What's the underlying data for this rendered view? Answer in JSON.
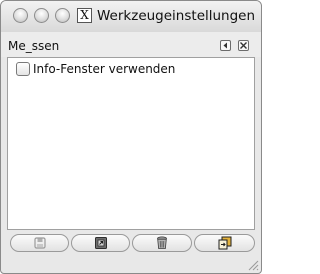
{
  "window": {
    "title": "Werkzeugeinstellungen",
    "app_icon_glyph": "X"
  },
  "dock": {
    "title": "Me_ssen",
    "menu_button_icon": "panel-menu-icon",
    "close_button_icon": "panel-close-icon"
  },
  "options": {
    "info_window_label": "Info-Fenster verwenden",
    "info_window_checked": false
  },
  "toolbar": {
    "buttons": [
      {
        "icon": "save-icon",
        "enabled": false
      },
      {
        "icon": "restore-icon",
        "enabled": true
      },
      {
        "icon": "delete-icon",
        "enabled": true
      },
      {
        "icon": "reset-icon",
        "enabled": true
      }
    ]
  },
  "colors": {
    "window_bg": "#e8e8e8",
    "content_bg": "#ffffff",
    "reset_icon_accent": "#e2b13c"
  }
}
